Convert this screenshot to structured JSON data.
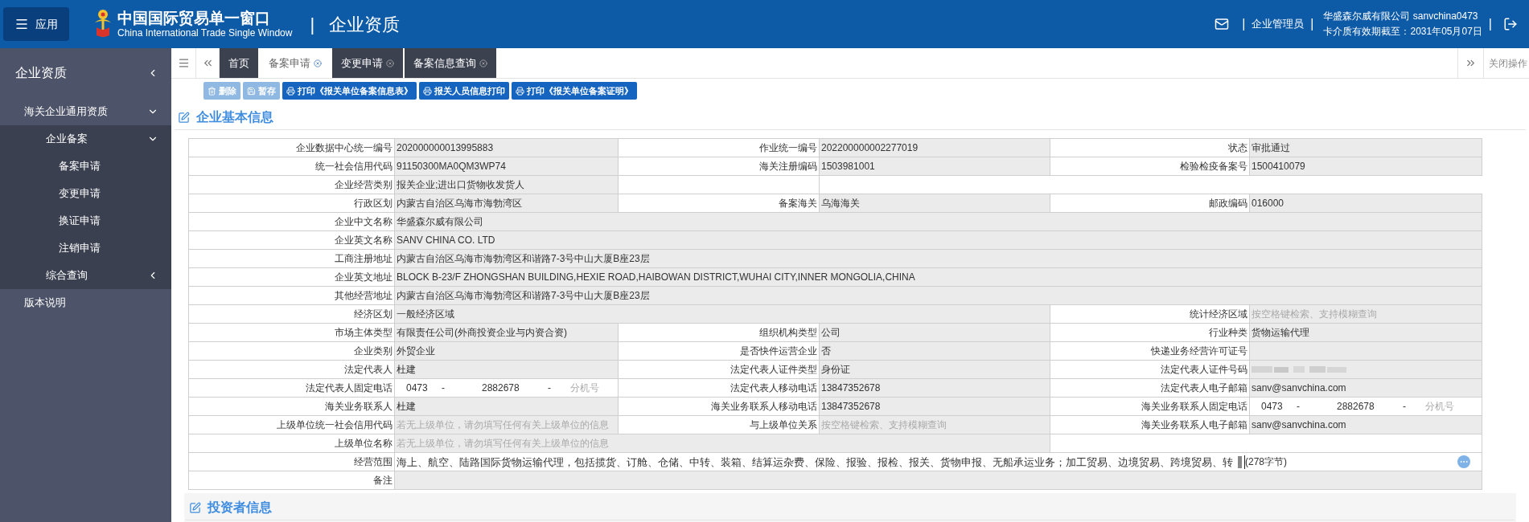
{
  "header": {
    "app_button": "应用",
    "title_cn": "中国国际贸易单一窗口",
    "title_en": "China International Trade Single Window",
    "separator": "|",
    "module": "企业资质",
    "role": "企业管理员",
    "company": "华盛森尔威有限公司 sanvchina0473",
    "card_expiry": "卡介质有效期截至：2031年05月07日"
  },
  "sidebar": {
    "title": "企业资质",
    "items": [
      {
        "label": "海关企业通用资质",
        "expanded": true,
        "children": [
          {
            "label": "企业备案",
            "expanded": true,
            "children": [
              {
                "label": "备案申请"
              },
              {
                "label": "变更申请"
              },
              {
                "label": "换证申请"
              },
              {
                "label": "注销申请"
              }
            ]
          },
          {
            "label": "综合查询",
            "expanded": false
          }
        ]
      },
      {
        "label": "版本说明"
      }
    ]
  },
  "tabs": [
    {
      "label": "首页",
      "selected": false,
      "closable": false
    },
    {
      "label": "备案申请",
      "selected": true,
      "closable": true
    },
    {
      "label": "变更申请",
      "selected": false,
      "closable": true
    },
    {
      "label": "备案信息查询",
      "selected": false,
      "closable": true
    }
  ],
  "close_menu": "关闭操作",
  "toolbar": [
    {
      "label": "删除",
      "kind": "delete",
      "disabled": true
    },
    {
      "label": "暂存",
      "kind": "save",
      "disabled": true
    },
    {
      "label": "打印《报关单位备案信息表》",
      "kind": "print",
      "disabled": false
    },
    {
      "label": "报关人员信息打印",
      "kind": "print",
      "disabled": false
    },
    {
      "label": "打印《报关单位备案证明》",
      "kind": "print",
      "disabled": false
    }
  ],
  "section_title": "企业基本信息",
  "rows": [
    {
      "kind": "triple",
      "cells": [
        {
          "label": "企业数据中心统一编号",
          "kind": "text",
          "value": "202000000013995883"
        },
        {
          "label": "作业统一编号",
          "kind": "text",
          "value": "202200000002277019"
        },
        {
          "label": "状态",
          "kind": "text",
          "value": "审批通过"
        }
      ]
    },
    {
      "kind": "triple",
      "cells": [
        {
          "label": "统一社会信用代码",
          "kind": "text",
          "value": "91150300MA0QM3WP74"
        },
        {
          "label": "海关注册编码",
          "kind": "text",
          "value": "1503981001"
        },
        {
          "label": "检验检疫备案号",
          "kind": "text",
          "value": "1500410079"
        }
      ]
    },
    {
      "kind": "half",
      "cells": [
        {
          "label": "企业经营类别",
          "kind": "text",
          "value": "报关企业;进出口货物收发货人"
        }
      ]
    },
    {
      "kind": "triple",
      "cells": [
        {
          "label": "行政区划",
          "kind": "text",
          "value": "内蒙古自治区乌海市海勃湾区"
        },
        {
          "label": "备案海关",
          "kind": "text",
          "value": "乌海海关"
        },
        {
          "label": "邮政编码",
          "kind": "text",
          "value": "016000"
        }
      ]
    },
    {
      "kind": "single",
      "cells": [
        {
          "label": "企业中文名称",
          "kind": "text",
          "value": "华盛森尔威有限公司"
        }
      ]
    },
    {
      "kind": "single",
      "cells": [
        {
          "label": "企业英文名称",
          "kind": "text",
          "value": "SANV CHINA CO. LTD"
        }
      ]
    },
    {
      "kind": "single",
      "cells": [
        {
          "label": "工商注册地址",
          "kind": "text",
          "value": "内蒙古自治区乌海市海勃湾区和谐路7-3号中山大厦B座23层"
        }
      ]
    },
    {
      "kind": "single",
      "cells": [
        {
          "label": "企业英文地址",
          "kind": "text",
          "value": "BLOCK B-23/F ZHONGSHAN BUILDING,HEXIE ROAD,HAIBOWAN DISTRICT,WUHAI CITY,INNER MONGOLIA,CHINA"
        }
      ]
    },
    {
      "kind": "single",
      "cells": [
        {
          "label": "其他经营地址",
          "kind": "text",
          "value": "内蒙古自治区乌海市海勃湾区和谐路7-3号中山大厦B座23层"
        }
      ]
    },
    {
      "kind": "wide_pair",
      "cells": [
        {
          "label": "经济区划",
          "kind": "text",
          "value": "一般经济区域"
        },
        {
          "label": "统计经济区域",
          "kind": "placeholder",
          "placeholder": "按空格键检索、支持模糊查询"
        }
      ]
    },
    {
      "kind": "triple",
      "cells": [
        {
          "label": "市场主体类型",
          "kind": "text",
          "value": "有限责任公司(外商投资企业与内资合资)"
        },
        {
          "label": "组织机构类型",
          "kind": "text",
          "value": "公司"
        },
        {
          "label": "行业种类",
          "kind": "text",
          "value": "货物运输代理"
        }
      ]
    },
    {
      "kind": "triple",
      "cells": [
        {
          "label": "企业类别",
          "kind": "text",
          "value": "外贸企业"
        },
        {
          "label": "是否快件运营企业",
          "kind": "text",
          "value": "否"
        },
        {
          "label": "快递业务经营许可证号",
          "kind": "empty"
        }
      ]
    },
    {
      "kind": "triple",
      "cells": [
        {
          "label": "法定代表人",
          "kind": "text",
          "value": "杜建"
        },
        {
          "label": "法定代表人证件类型",
          "kind": "text",
          "value": "身份证"
        },
        {
          "label": "法定代表人证件号码",
          "kind": "redacted"
        }
      ]
    },
    {
      "kind": "triple",
      "cells": [
        {
          "label": "法定代表人固定电话",
          "kind": "phone",
          "area": "0473",
          "number": "2882678",
          "separators": [
            "-",
            "-"
          ],
          "extension_placeholder": "分机号"
        },
        {
          "label": "法定代表人移动电话",
          "kind": "text",
          "value": "13847352678"
        },
        {
          "label": "法定代表人电子邮箱",
          "kind": "text",
          "value": "sanv@sanvchina.com"
        }
      ]
    },
    {
      "kind": "triple",
      "cells": [
        {
          "label": "海关业务联系人",
          "kind": "text",
          "value": "杜建"
        },
        {
          "label": "海关业务联系人移动电话",
          "kind": "text",
          "value": "13847352678"
        },
        {
          "label": "海关业务联系人固定电话",
          "kind": "phone",
          "area": "0473",
          "number": "2882678",
          "separators": [
            "-",
            "-"
          ],
          "extension_placeholder": "分机号"
        }
      ]
    },
    {
      "kind": "triple",
      "cells": [
        {
          "label": "上级单位统一社会信用代码",
          "kind": "placeholder",
          "placeholder": "若无上级单位，请勿填写任何有关上级单位的信息"
        },
        {
          "label": "与上级单位关系",
          "kind": "placeholder",
          "placeholder": "按空格键检索、支持模糊查询"
        },
        {
          "label": "海关业务联系人电子邮箱",
          "kind": "text",
          "value": "sanv@sanvchina.com"
        }
      ]
    },
    {
      "kind": "wide_half",
      "cells": [
        {
          "label": "上级单位名称",
          "kind": "placeholder",
          "placeholder": "若无上级单位，请勿填写任何有关上级单位的信息"
        }
      ]
    },
    {
      "kind": "single",
      "cells": [
        {
          "label": "经营范围",
          "kind": "scope",
          "value": "海上、航空、陆路国际货物运输代理，包括揽货、订舱、仓储、中转、装箱、结算运杂费、保险、报验、报检、报关、货物申报、无船承运业务；加工贸易、边境贸易、跨境贸易、转",
          "count": "(278字节)"
        }
      ]
    },
    {
      "kind": "single",
      "cells": [
        {
          "label": "备注",
          "kind": "empty"
        }
      ]
    }
  ],
  "next_section_title": "投资者信息"
}
